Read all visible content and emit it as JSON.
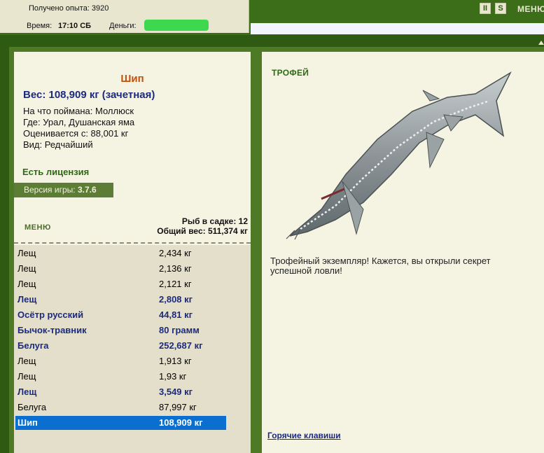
{
  "top": {
    "xp_text": "Получено опыта: 3920",
    "time_label": "Время:",
    "time_value": "17:10 СБ",
    "money_label": "Деньги:",
    "menu_label": "МЕНЮ",
    "icon_pause": "II",
    "icon_s": "S"
  },
  "fish": {
    "name": "Шип",
    "weight": "Вес: 108,909 кг (зачетная)",
    "caught_on": "На что поймана: Моллюск",
    "where": "Где: Урал, Душанская яма",
    "valued_from": "Оценивается с: 88,001 кг",
    "kind": "Вид: Редчайший"
  },
  "license": "Есть лицензия",
  "version": {
    "label": "Версия игры:",
    "value": "3.7.6"
  },
  "menu_button": "МЕНЮ",
  "cage": {
    "count": "Рыб в садке: 12",
    "total": "Общий вес: 511,374 кг"
  },
  "catch_list": [
    {
      "name": "Лещ",
      "weight": "2,434 кг",
      "style": "normal"
    },
    {
      "name": "Лещ",
      "weight": "2,136 кг",
      "style": "normal"
    },
    {
      "name": "Лещ",
      "weight": "2,121 кг",
      "style": "normal"
    },
    {
      "name": "Лещ",
      "weight": "2,808 кг",
      "style": "highlight"
    },
    {
      "name": "Осётр русский",
      "weight": "44,81 кг",
      "style": "highlight"
    },
    {
      "name": "Бычок-травник",
      "weight": "80 грамм",
      "style": "highlight"
    },
    {
      "name": "Белуга",
      "weight": "252,687 кг",
      "style": "highlight"
    },
    {
      "name": "Лещ",
      "weight": "1,913 кг",
      "style": "normal"
    },
    {
      "name": "Лещ",
      "weight": "1,93 кг",
      "style": "normal"
    },
    {
      "name": "Лещ",
      "weight": "3,549 кг",
      "style": "highlight"
    },
    {
      "name": "Белуга",
      "weight": "87,997 кг",
      "style": "normal"
    },
    {
      "name": "Шип",
      "weight": "108,909 кг",
      "style": "selected"
    }
  ],
  "trophy": {
    "label": "ТРОФЕЙ",
    "description": "Трофейный экземпляр! Кажется, вы открыли секрет успешной ловли!"
  },
  "hotkeys": "Горячие клавиши",
  "colors": {
    "panel_green": "#4e7a26",
    "header_green": "#3c6e1a",
    "selected_row": "#0a6fd1",
    "highlight_text": "#1c2a80",
    "name_orange": "#c0520f"
  }
}
